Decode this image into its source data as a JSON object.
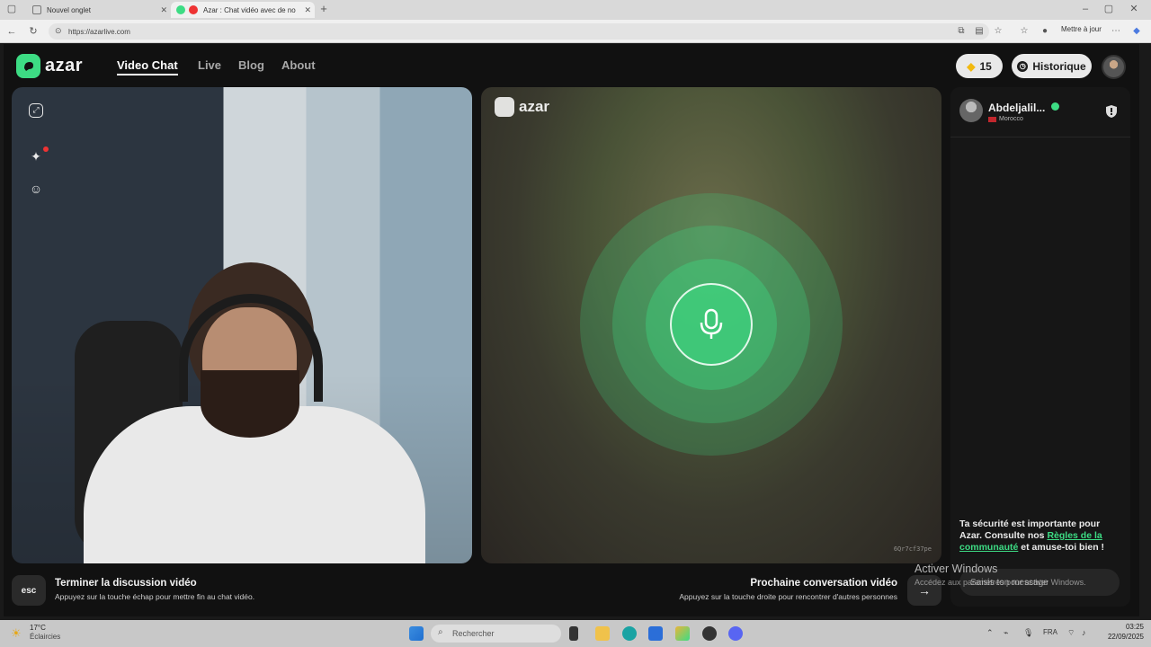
{
  "browser": {
    "tabs": [
      {
        "label": "Nouvel onglet",
        "active": false
      },
      {
        "label": "Azar : Chat vidéo avec de no",
        "active": true
      }
    ],
    "url": "https://azarlive.com",
    "update_label": "Mettre à jour"
  },
  "app": {
    "logo_text": "azar",
    "nav": [
      {
        "label": "Video Chat",
        "active": true
      },
      {
        "label": "Live",
        "active": false
      },
      {
        "label": "Blog",
        "active": false
      },
      {
        "label": "About",
        "active": false
      }
    ],
    "gems_count": "15",
    "history_label": "Historique",
    "accent_color": "#3ddc84"
  },
  "remote": {
    "logo_text": "azar",
    "session_code": "6Qr7cf37pe"
  },
  "chat": {
    "partner_name": "Abdeljalil...",
    "partner_country": "Morocco",
    "safety_text_1": "Ta sécurité est importante pour Azar. Consulte nos ",
    "safety_link": "Règles de la communauté",
    "safety_text_2": " et amuse-toi bien !",
    "input_placeholder": "Saisis ton message"
  },
  "footer": {
    "esc_label": "esc",
    "end_title": "Terminer la discussion vidéo",
    "end_sub": "Appuyez sur la touche échap pour mettre fin au chat vidéo.",
    "next_title": "Prochaine conversation vidéo",
    "next_sub": "Appuyez sur la touche droite pour rencontrer d'autres personnes"
  },
  "watermark": {
    "title": "Activer Windows",
    "sub": "Accédez aux paramètres pour activer Windows."
  },
  "taskbar": {
    "weather_temp": "17°C",
    "weather_desc": "Éclaircies",
    "search_placeholder": "Rechercher",
    "lang": "FRA",
    "time": "03:25",
    "date": "22/09/2025"
  }
}
